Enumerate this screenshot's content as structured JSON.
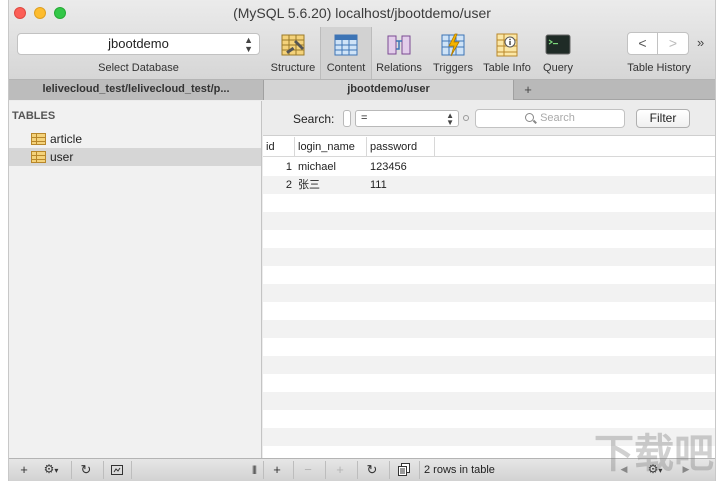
{
  "window": {
    "title": "(MySQL 5.6.20) localhost/jbootdemo/user"
  },
  "toolbar": {
    "database": {
      "value": "jbootdemo",
      "label": "Select Database"
    },
    "tools": [
      {
        "label": "Structure",
        "icon": "structure-icon"
      },
      {
        "label": "Content",
        "icon": "content-icon",
        "active": true
      },
      {
        "label": "Relations",
        "icon": "relations-icon"
      },
      {
        "label": "Triggers",
        "icon": "triggers-icon"
      },
      {
        "label": "Table Info",
        "icon": "table-info-icon"
      },
      {
        "label": "Query",
        "icon": "query-icon"
      }
    ],
    "history_label": "Table History",
    "back_glyph": "<",
    "forward_glyph": ">",
    "overflow_glyph": "»"
  },
  "tabs": [
    {
      "label": "lelivecloud_test/lelivecloud_test/p..."
    },
    {
      "label": "jbootdemo/user",
      "active": true
    }
  ],
  "tab_add_glyph": "+",
  "sidebar": {
    "header": "TABLES",
    "tables": [
      {
        "name": "article",
        "selected": false
      },
      {
        "name": "user",
        "selected": true
      }
    ]
  },
  "filter": {
    "search_label": "Search:",
    "operator": "=",
    "search_placeholder": "Search",
    "filter_button": "Filter"
  },
  "grid": {
    "columns": [
      "id",
      "login_name",
      "password"
    ],
    "rows": [
      [
        "1",
        "michael",
        "123456"
      ],
      [
        "2",
        "张三",
        "111"
      ]
    ]
  },
  "bottombar": {
    "add": "+",
    "gear": "⚙",
    "gear_caret": "▾",
    "refresh": "↻",
    "split": "|||",
    "add_row": "+",
    "remove_row": "−",
    "duplicate_row": "+",
    "refresh_rows": "↻",
    "status": "2 rows in table",
    "prev": "◀",
    "next": "▶"
  },
  "watermark": "下载吧",
  "colors": {
    "accent_active_tool": "#d2d2d2",
    "stripe": "#f2f2f2",
    "selection": "#d6d6d6"
  }
}
